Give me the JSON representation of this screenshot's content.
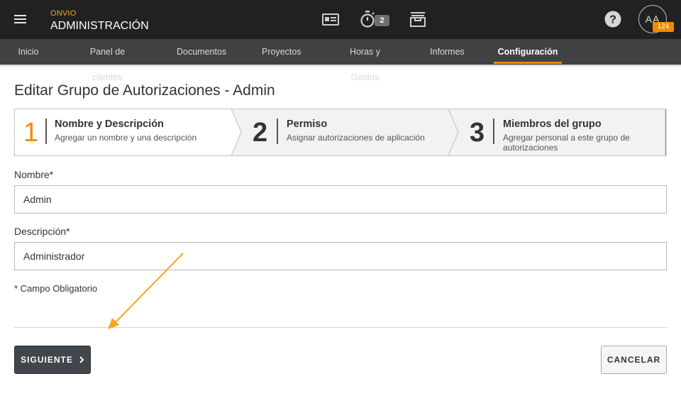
{
  "header": {
    "brand_sub": "ONVIO",
    "brand_title": "ADMINISTRACIÓN",
    "timer_count": "2",
    "avatar_initials": "AA",
    "notification_count": "124",
    "icons": [
      "hamburger-menu-icon",
      "contact-card-icon",
      "stopwatch-icon",
      "archive-tray-icon",
      "help-icon"
    ]
  },
  "nav": {
    "items": [
      {
        "label": "Inicio",
        "active": false
      },
      {
        "label": "Panel de clientes",
        "active": false
      },
      {
        "label": "Documentos",
        "active": false
      },
      {
        "label": "Proyectos",
        "active": false
      },
      {
        "label": "Horas y Gastos",
        "active": false
      },
      {
        "label": "Informes",
        "active": false
      },
      {
        "label": "Configuración",
        "active": true
      }
    ]
  },
  "page": {
    "title": "Editar Grupo de Autorizaciones - Admin"
  },
  "stepper": {
    "steps": [
      {
        "number": "1",
        "title": "Nombre y Descripción",
        "description": "Agregar un nombre y una descripción",
        "current": true
      },
      {
        "number": "2",
        "title": "Permiso",
        "description": "Asignar autorizaciones de aplicación",
        "current": false
      },
      {
        "number": "3",
        "title": "Miembros del grupo",
        "description": "Agregar personal a este grupo de autorizaciones",
        "current": false
      }
    ]
  },
  "form": {
    "name_label": "Nombre*",
    "name_value": "Admin",
    "description_label": "Descripción*",
    "description_value": "Administrador",
    "required_note": "* Campo Obligatorio"
  },
  "actions": {
    "next_label": "SIGUIENTE",
    "cancel_label": "CANCELAR"
  },
  "colors": {
    "accent": "#f08c00",
    "topbar": "#212121",
    "navbar": "#414141",
    "annotation_arrow": "#f5a623"
  }
}
